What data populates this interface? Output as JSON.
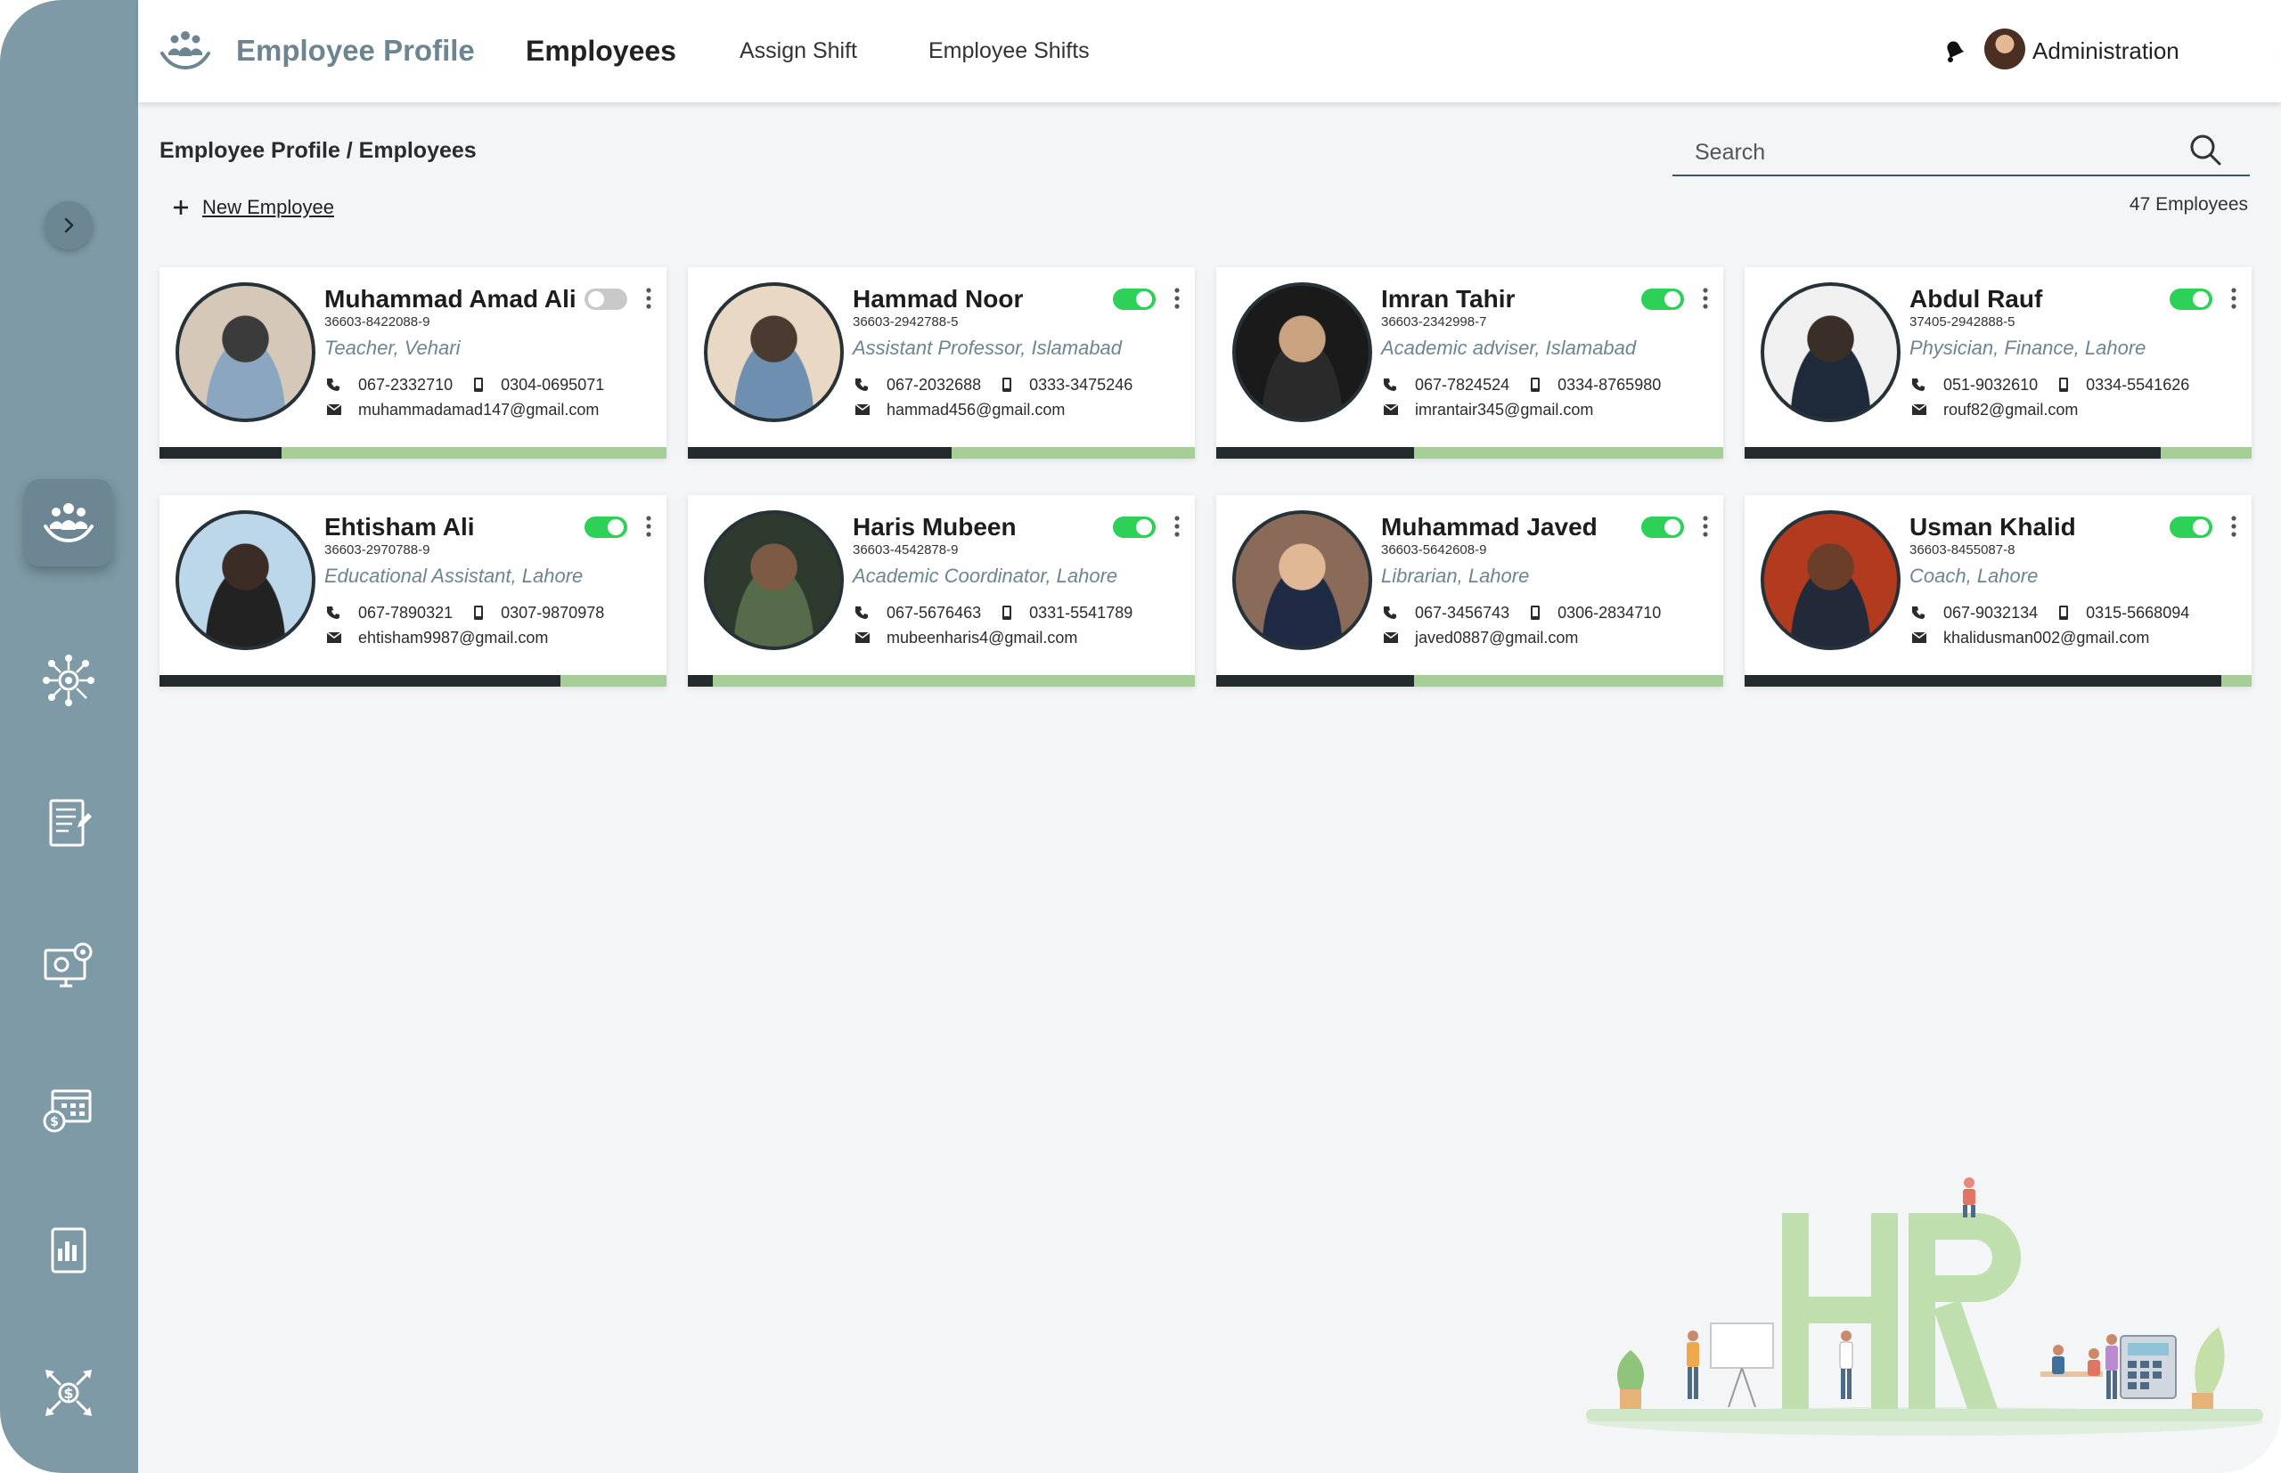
{
  "header": {
    "app_title": "Employee Profile",
    "nav": {
      "employees": "Employees",
      "assign_shift": "Assign Shift",
      "employee_shifts": "Employee Shifts"
    },
    "user_name": "Administration"
  },
  "breadcrumb": "Employee Profile / Employees",
  "search": {
    "placeholder": "Search"
  },
  "new_employee_label": "New Employee",
  "employee_count": "47 Employees",
  "sidebar": {
    "items": [
      {
        "icon": "team-icon",
        "active": true
      },
      {
        "icon": "network-icon",
        "active": false
      },
      {
        "icon": "checklist-icon",
        "active": false
      },
      {
        "icon": "monitor-settings-icon",
        "active": false
      },
      {
        "icon": "calendar-payroll-icon",
        "active": false
      },
      {
        "icon": "report-icon",
        "active": false
      },
      {
        "icon": "salary-arrows-icon",
        "active": false
      }
    ]
  },
  "employees": [
    {
      "name": "Muhammad Amad Ali",
      "cnic": "36603-8422088-9",
      "role": "Teacher, Vehari",
      "phone": "067-2332710",
      "mobile": "0304-0695071",
      "email": "muhammadamad147@gmail.com",
      "active": false,
      "progress": 0.24
    },
    {
      "name": "Hammad Noor",
      "cnic": "36603-2942788-5",
      "role": "Assistant Professor, Islamabad",
      "phone": "067-2032688",
      "mobile": "0333-3475246",
      "email": "hammad456@gmail.com",
      "active": true,
      "progress": 0.52
    },
    {
      "name": "Imran Tahir",
      "cnic": "36603-2342998-7",
      "role": "Academic adviser, Islamabad",
      "phone": "067-7824524",
      "mobile": "0334-8765980",
      "email": "imrantair345@gmail.com",
      "active": true,
      "progress": 0.39
    },
    {
      "name": "Abdul Rauf",
      "cnic": "37405-2942888-5",
      "role": "Physician, Finance, Lahore",
      "phone": "051-9032610",
      "mobile": "0334-5541626",
      "email": "rouf82@gmail.com",
      "active": true,
      "progress": 0.82
    },
    {
      "name": "Ehtisham Ali",
      "cnic": "36603-2970788-9",
      "role": "Educational Assistant, Lahore",
      "phone": "067-7890321",
      "mobile": "0307-9870978",
      "email": "ehtisham9987@gmail.com",
      "active": true,
      "progress": 0.79
    },
    {
      "name": "Haris Mubeen",
      "cnic": "36603-4542878-9",
      "role": "Academic Coordinator, Lahore",
      "phone": "067-5676463",
      "mobile": "0331-5541789",
      "email": "mubeenharis4@gmail.com",
      "active": true,
      "progress": 0.05
    },
    {
      "name": "Muhammad Javed",
      "cnic": "36603-5642608-9",
      "role": "Librarian, Lahore",
      "phone": "067-3456743",
      "mobile": "0306-2834710",
      "email": "javed0887@gmail.com",
      "active": true,
      "progress": 0.39
    },
    {
      "name": "Usman Khalid",
      "cnic": "36603-8455087-8",
      "role": "Coach, Lahore",
      "phone": "067-9032134",
      "mobile": "0315-5668094",
      "email": "khalidusman002@gmail.com",
      "active": true,
      "progress": 0.94
    }
  ],
  "colors": {
    "sidebar": "#7e9aa6",
    "accent": "#6d8591",
    "toggle_on": "#2ed158",
    "progress_track": "#a6cf98",
    "progress_fill": "#222a2d"
  }
}
